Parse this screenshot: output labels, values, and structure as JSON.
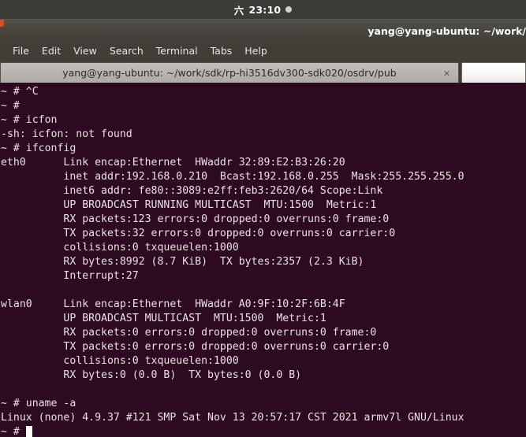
{
  "top_panel": {
    "weekday": "六",
    "time": "23:10",
    "indicator_icon": "circle-indicator-icon"
  },
  "window": {
    "title": "yang@yang-ubuntu: ~/work/",
    "accent_color": "#e04a24"
  },
  "menubar": {
    "items": [
      {
        "label": "File"
      },
      {
        "label": "Edit"
      },
      {
        "label": "View"
      },
      {
        "label": "Search"
      },
      {
        "label": "Terminal"
      },
      {
        "label": "Tabs"
      },
      {
        "label": "Help"
      }
    ]
  },
  "tabs": {
    "active_tab_label": "yang@yang-ubuntu: ~/work/sdk/rp-hi3516dv300-sdk020/osdrv/pub",
    "close_icon": "×",
    "second_tab_label": ""
  },
  "terminal": {
    "background_color": "#2d0922",
    "foreground_color": "#e8e4e0",
    "lines": [
      "~ # ^C",
      "~ #",
      "~ # icfon",
      "-sh: icfon: not found",
      "~ # ifconfig",
      "eth0      Link encap:Ethernet  HWaddr 32:89:E2:B3:26:20",
      "          inet addr:192.168.0.210  Bcast:192.168.0.255  Mask:255.255.255.0",
      "          inet6 addr: fe80::3089:e2ff:feb3:2620/64 Scope:Link",
      "          UP BROADCAST RUNNING MULTICAST  MTU:1500  Metric:1",
      "          RX packets:123 errors:0 dropped:0 overruns:0 frame:0",
      "          TX packets:32 errors:0 dropped:0 overruns:0 carrier:0",
      "          collisions:0 txqueuelen:1000",
      "          RX bytes:8992 (8.7 KiB)  TX bytes:2357 (2.3 KiB)",
      "          Interrupt:27",
      "",
      "wlan0     Link encap:Ethernet  HWaddr A0:9F:10:2F:6B:4F",
      "          UP BROADCAST MULTICAST  MTU:1500  Metric:1",
      "          RX packets:0 errors:0 dropped:0 overruns:0 frame:0",
      "          TX packets:0 errors:0 dropped:0 overruns:0 carrier:0",
      "          collisions:0 txqueuelen:1000",
      "          RX bytes:0 (0.0 B)  TX bytes:0 (0.0 B)",
      "",
      "~ # uname -a",
      "Linux (none) 4.9.37 #121 SMP Sat Nov 13 20:57:17 CST 2021 armv7l GNU/Linux"
    ],
    "prompt": "~ # "
  }
}
